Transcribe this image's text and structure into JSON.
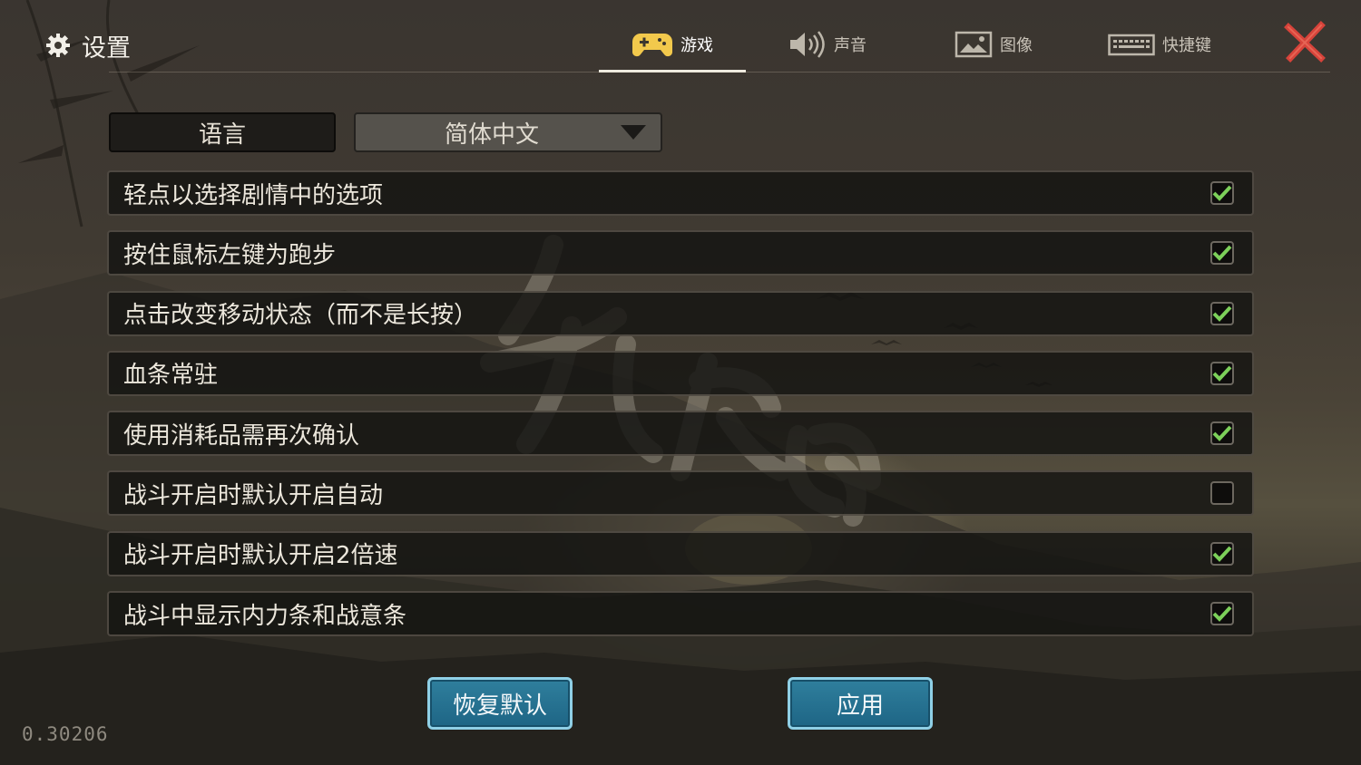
{
  "header": {
    "title": "设置",
    "tabs": [
      {
        "label": "游戏",
        "icon": "gamepad-icon",
        "active": true
      },
      {
        "label": "声音",
        "icon": "speaker-icon",
        "active": false
      },
      {
        "label": "图像",
        "icon": "picture-icon",
        "active": false
      },
      {
        "label": "快捷键",
        "icon": "keyboard-icon",
        "active": false
      }
    ],
    "close_icon": "close-icon"
  },
  "language": {
    "label": "语言",
    "value": "简体中文"
  },
  "options": [
    {
      "label": "轻点以选择剧情中的选项",
      "checked": true
    },
    {
      "label": "按住鼠标左键为跑步",
      "checked": true
    },
    {
      "label": "点击改变移动状态（而不是长按）",
      "checked": true
    },
    {
      "label": "血条常驻",
      "checked": true
    },
    {
      "label": "使用消耗品需再次确认",
      "checked": true
    },
    {
      "label": "战斗开启时默认开启自动",
      "checked": false
    },
    {
      "label": "战斗开启时默认开启2倍速",
      "checked": true
    },
    {
      "label": "战斗中显示内力条和战意条",
      "checked": true
    }
  ],
  "buttons": {
    "restore": "恢复默认",
    "apply": "应用"
  },
  "version": "0.30206",
  "colors": {
    "accent_blue": "#2a7898",
    "check_green": "#7cd05a",
    "close_red": "#d7433a"
  }
}
